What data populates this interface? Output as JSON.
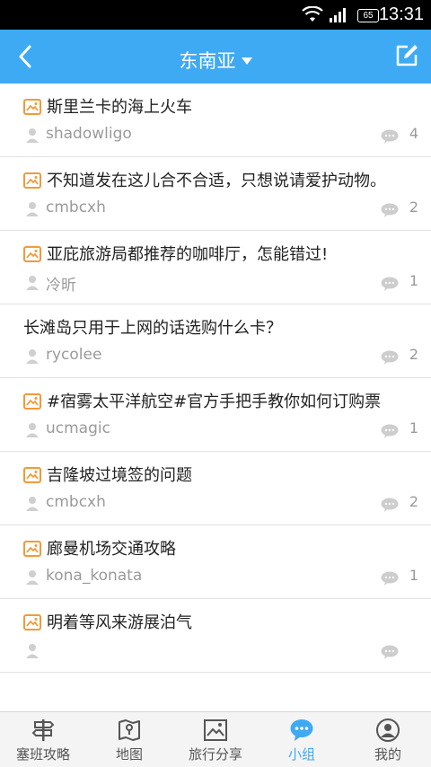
{
  "status_bar": {
    "time": "13:31",
    "battery": "65"
  },
  "header": {
    "title": "东南亚"
  },
  "posts": [
    {
      "title": "斯里兰卡的海上火车",
      "author": "shadowligo",
      "replies": "4",
      "has_image": true
    },
    {
      "title": "不知道发在这儿合不合适，只想说请爱护动物。",
      "author": "cmbcxh",
      "replies": "2",
      "has_image": true
    },
    {
      "title": "亚庇旅游局都推荐的咖啡厅，怎能错过!",
      "author": "冷昕",
      "replies": "1",
      "has_image": true
    },
    {
      "title": "长滩岛只用于上网的话选购什么卡？",
      "author": "rycolee",
      "replies": "2",
      "has_image": false
    },
    {
      "title": "#宿雾太平洋航空#官方手把手教你如何订购票",
      "author": "ucmagic",
      "replies": "1",
      "has_image": true
    },
    {
      "title": "吉隆坡过境签的问题",
      "author": "cmbcxh",
      "replies": "2",
      "has_image": true
    },
    {
      "title": "廊曼机场交通攻略",
      "author": "kona_konata",
      "replies": "1",
      "has_image": true
    },
    {
      "title": "明着等风来游展泊气",
      "author": "",
      "replies": "",
      "has_image": true
    }
  ],
  "tabs": [
    {
      "label": "塞班攻略",
      "icon": "signpost-icon",
      "active": false
    },
    {
      "label": "地图",
      "icon": "map-icon",
      "active": false
    },
    {
      "label": "旅行分享",
      "icon": "photo-icon",
      "active": false
    },
    {
      "label": "小组",
      "icon": "chat-icon",
      "active": true
    },
    {
      "label": "我的",
      "icon": "profile-icon",
      "active": false
    }
  ],
  "colors": {
    "accent": "#3eaaf3",
    "image_badge": "#f29a3a",
    "muted": "#9a9a9a"
  }
}
